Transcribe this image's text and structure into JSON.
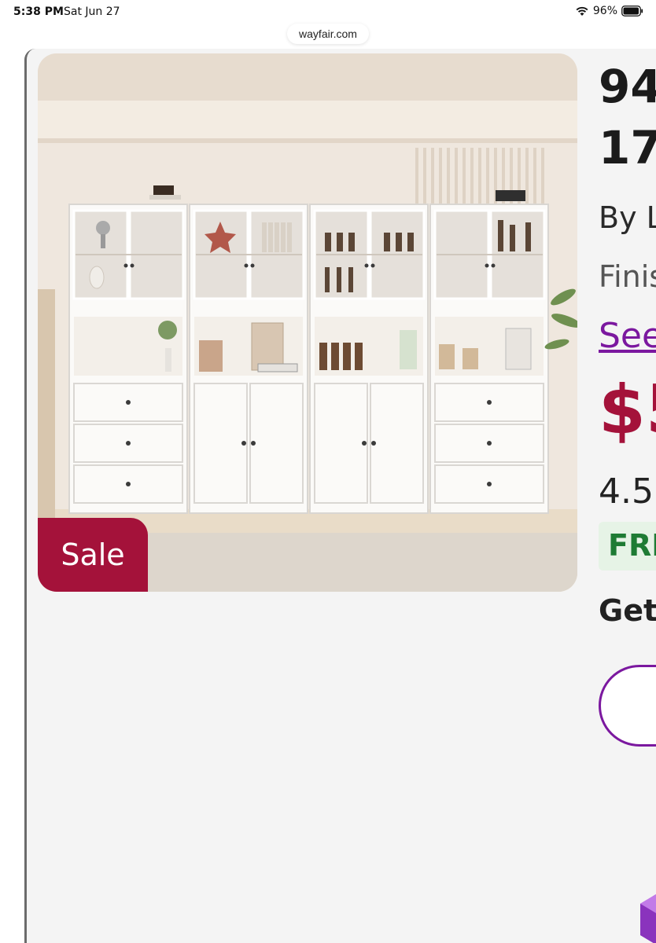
{
  "status_bar": {
    "time": "5:38 PM",
    "date": "Sat Jun 27",
    "battery": "96%"
  },
  "browser": {
    "url": "wayfair.com"
  },
  "product": {
    "sale_badge": "Sale",
    "title_line1": "94",
    "title_line2": "17.",
    "by_brand": "By L",
    "finish": "Finis",
    "see_link": "See",
    "price": "$5",
    "rating": "4.5",
    "shipping_badge": "FRI",
    "get_text": "Get"
  },
  "colors": {
    "sale": "#a4123a",
    "link": "#7b189f",
    "free_shipping_text": "#1e7b34",
    "free_shipping_bg": "#e6f3e6"
  },
  "icons": {
    "wifi": "wifi-icon",
    "battery": "battery-icon"
  }
}
